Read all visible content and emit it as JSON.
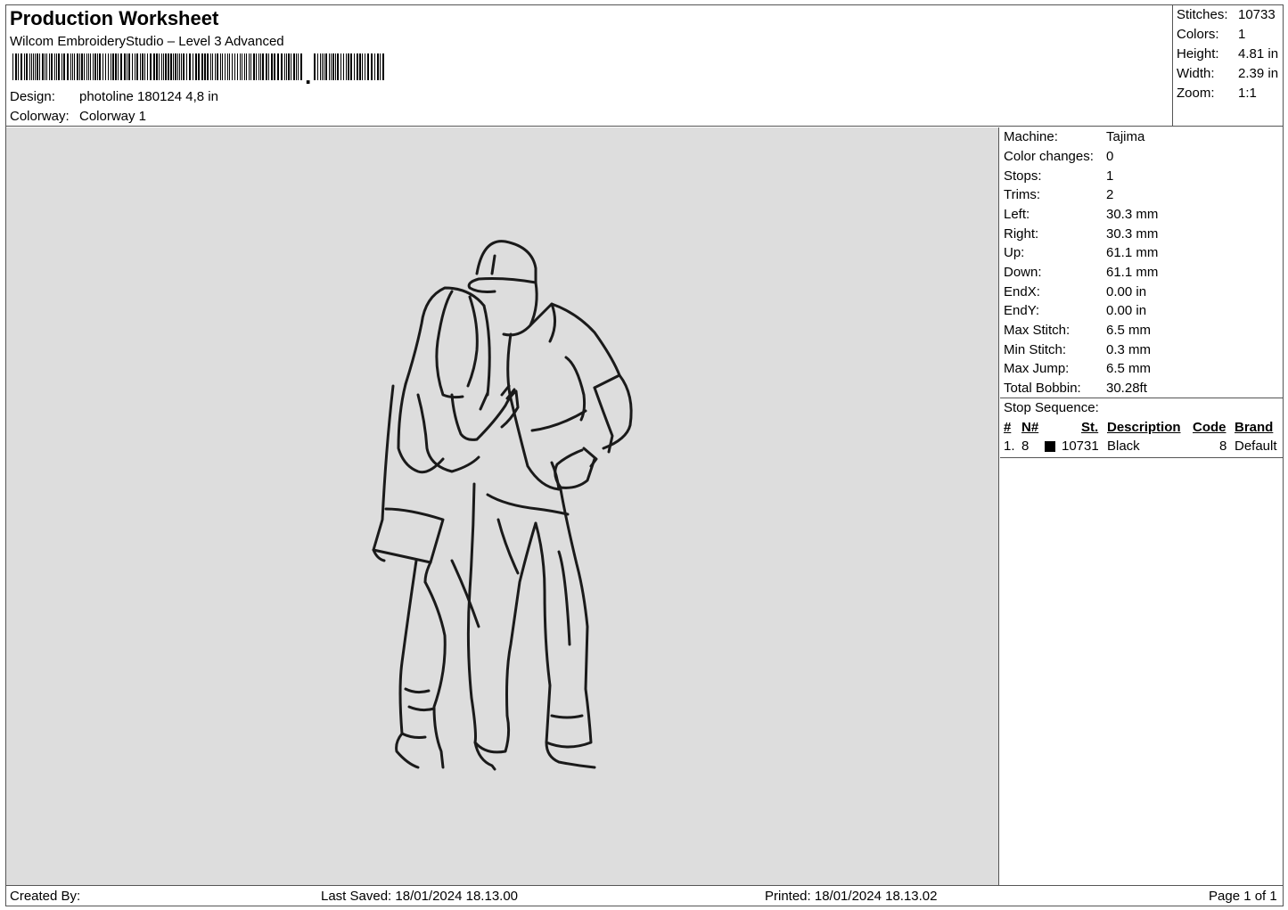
{
  "header": {
    "title": "Production Worksheet",
    "subtitle": "Wilcom EmbroideryStudio – Level 3 Advanced",
    "design_label": "Design:",
    "design_value": "photoline 180124 4,8 in",
    "colorway_label": "Colorway:",
    "colorway_value": "Colorway 1"
  },
  "summary": {
    "stitches_label": "Stitches:",
    "stitches_value": "10733",
    "colors_label": "Colors:",
    "colors_value": "1",
    "height_label": "Height:",
    "height_value": "4.81 in",
    "width_label": "Width:",
    "width_value": "2.39 in",
    "zoom_label": "Zoom:",
    "zoom_value": "1:1"
  },
  "machine": {
    "machine_label": "Machine:",
    "machine_value": "Tajima",
    "color_changes_label": "Color changes:",
    "color_changes_value": "0",
    "stops_label": "Stops:",
    "stops_value": "1",
    "trims_label": "Trims:",
    "trims_value": "2",
    "left_label": "Left:",
    "left_value": "30.3 mm",
    "right_label": "Right:",
    "right_value": "30.3 mm",
    "up_label": "Up:",
    "up_value": "61.1 mm",
    "down_label": "Down:",
    "down_value": "61.1 mm",
    "endx_label": "EndX:",
    "endx_value": "0.00 in",
    "endy_label": "EndY:",
    "endy_value": "0.00 in",
    "max_stitch_label": "Max Stitch:",
    "max_stitch_value": "6.5 mm",
    "min_stitch_label": "Min Stitch:",
    "min_stitch_value": "0.3 mm",
    "max_jump_label": "Max Jump:",
    "max_jump_value": "6.5 mm",
    "total_bobbin_label": "Total Bobbin:",
    "total_bobbin_value": "30.28ft"
  },
  "stop_sequence": {
    "title": "Stop Sequence:",
    "columns": [
      "#",
      "N#",
      "St.",
      "Description",
      "Code",
      "Brand"
    ],
    "rows": [
      {
        "index": "1.",
        "needle": "8",
        "color": "#000000",
        "stitches": "10731",
        "description": "Black",
        "code": "8",
        "brand": "Default"
      }
    ]
  },
  "footer": {
    "created_by": "Created By:",
    "last_saved": "Last Saved: 18/01/2024 18.13.00",
    "printed": "Printed: 18/01/2024 18.13.02",
    "page": "Page 1 of 1"
  },
  "colors": {
    "design_background": "#dddddd",
    "thread": "#1a1a1a"
  }
}
